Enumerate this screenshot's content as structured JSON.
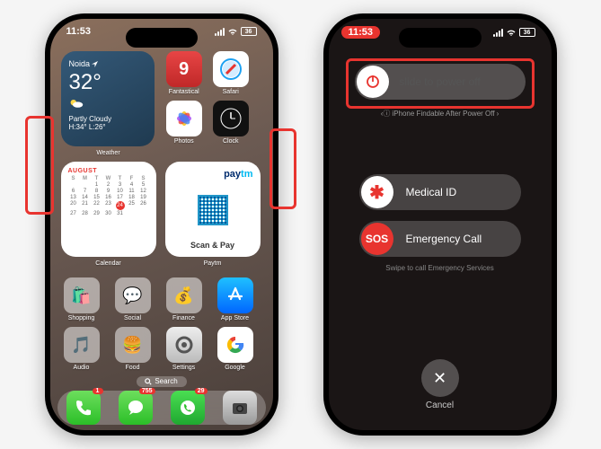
{
  "status": {
    "time": "11:53",
    "battery": "36"
  },
  "weather": {
    "city": "Noida",
    "temp": "32°",
    "condition": "Partly Cloudy",
    "high_low": "H:34° L:26°",
    "label": "Weather"
  },
  "widget_apps": {
    "fantastical": "Fantastical",
    "safari": "Safari",
    "photos": "Photos",
    "clock": "Clock"
  },
  "calendar": {
    "month": "AUGUST",
    "label": "Calendar",
    "today": "24"
  },
  "paytm": {
    "action": "Scan & Pay",
    "label": "Paytm"
  },
  "apps_row1": {
    "shopping": "Shopping",
    "social": "Social",
    "finance": "Finance",
    "appstore": "App Store"
  },
  "apps_row2": {
    "audio": "Audio",
    "food": "Food",
    "settings": "Settings",
    "google": "Google"
  },
  "search": "Search",
  "dock_badges": {
    "phone": "1",
    "messages": "755",
    "whatsapp": "29"
  },
  "power": {
    "slide": "slide to power off",
    "findable": "iPhone Findable After Power Off",
    "medical": "Medical ID",
    "sos_icon": "SOS",
    "sos": "Emergency Call",
    "swipe": "Swipe to call Emergency Services",
    "cancel": "Cancel"
  }
}
